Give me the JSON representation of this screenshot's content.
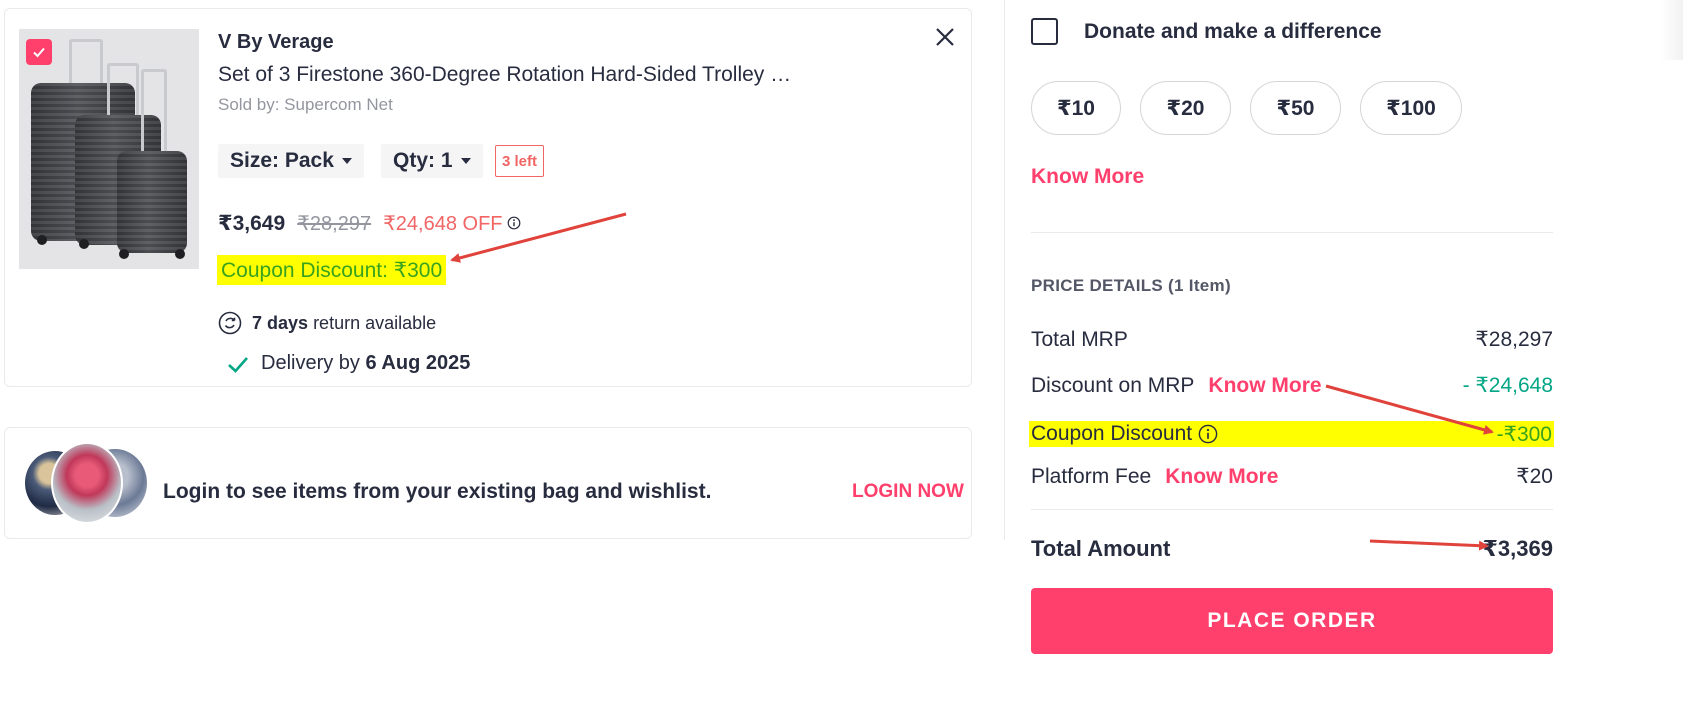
{
  "product": {
    "brand": "V By Verage",
    "name": "Set of 3 Firestone 360-Degree Rotation Hard-Sided Trolley …",
    "seller": "Sold by: Supercom Net",
    "size_label": "Size: Pack",
    "qty_label": "Qty: 1",
    "stock_badge": "3 left",
    "price_selling": "₹3,649",
    "price_mrp": "₹28,297",
    "price_off": "₹24,648 OFF",
    "coupon_discount": "Coupon Discount: ₹300",
    "return_days": "7 days",
    "return_text": "return available",
    "delivery_prefix": "Delivery by",
    "delivery_date": "6 Aug 2025"
  },
  "login": {
    "message": "Login to see items from your existing bag and wishlist.",
    "action": "LOGIN NOW"
  },
  "donate": {
    "label": "Donate and make a difference",
    "amounts": [
      "₹10",
      "₹20",
      "₹50",
      "₹100"
    ],
    "know_more": "Know More"
  },
  "price_details": {
    "title": "PRICE DETAILS (1 Item)",
    "total_mrp_label": "Total MRP",
    "total_mrp_value": "₹28,297",
    "discount_label": "Discount on MRP",
    "discount_know_more": "Know More",
    "discount_value": "- ₹24,648",
    "coupon_label": "Coupon Discount",
    "coupon_value": "-₹300",
    "platform_fee_label": "Platform Fee",
    "platform_fee_know_more": "Know More",
    "platform_fee_value": "₹20",
    "total_label": "Total Amount",
    "total_value": "₹3,369"
  },
  "place_order": "PLACE ORDER",
  "colors": {
    "accent": "#ff3f6c",
    "discount_green": "#03a685",
    "highlight": "#ffff00",
    "arrow": "#e0433b"
  }
}
